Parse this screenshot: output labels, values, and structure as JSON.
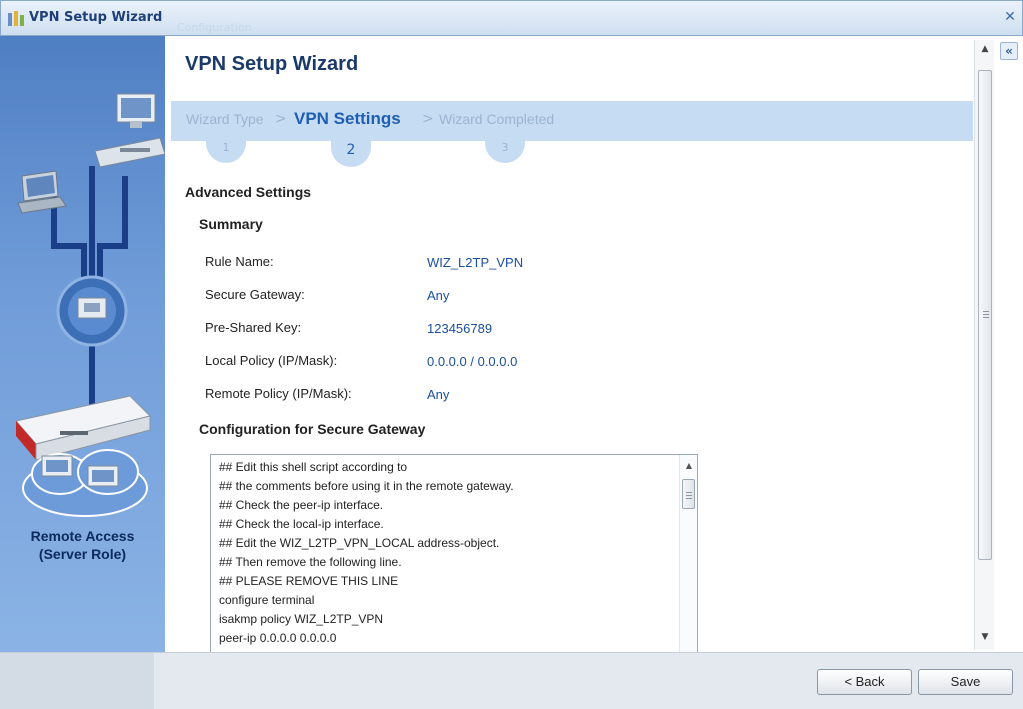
{
  "window": {
    "title": "VPN Setup Wizard",
    "ghost_tab": "Configuration"
  },
  "sidebar": {
    "role_line1": "Remote Access",
    "role_line2": "(Server Role)"
  },
  "main": {
    "page_title": "VPN Setup Wizard",
    "steps": [
      {
        "label": "Wizard Type",
        "number": "1",
        "active": false
      },
      {
        "label": "VPN Settings",
        "number": "2",
        "active": true
      },
      {
        "label": "Wizard Completed",
        "number": "3",
        "active": false
      }
    ],
    "step_separator": ">",
    "advanced_settings": "Advanced Settings",
    "summary_heading": "Summary",
    "summary": [
      {
        "label": "Rule Name:",
        "value": "WIZ_L2TP_VPN"
      },
      {
        "label": "Secure Gateway:",
        "value": "Any"
      },
      {
        "label": "Pre-Shared Key:",
        "value": "123456789"
      },
      {
        "label": "Local Policy (IP/Mask):",
        "value": "0.0.0.0 / 0.0.0.0"
      },
      {
        "label": "Remote Policy (IP/Mask):",
        "value": "Any"
      }
    ],
    "config_heading": "Configuration for Secure Gateway",
    "script_lines": [
      "## Edit this shell script according to",
      "## the comments before using it in the remote gateway.",
      "## Check the peer-ip interface.",
      "## Check the local-ip interface.",
      "## Edit the WIZ_L2TP_VPN_LOCAL address-object.",
      "## Then remove the following line.",
      "## PLEASE REMOVE THIS LINE",
      "configure terminal",
      "isakmp policy WIZ_L2TP_VPN",
      "peer-ip 0.0.0.0 0.0.0.0"
    ]
  },
  "footer": {
    "back_label": "< Back",
    "save_label": "Save"
  },
  "icons": {
    "close": "close-icon",
    "collapse": "double-chevron-left-icon"
  }
}
